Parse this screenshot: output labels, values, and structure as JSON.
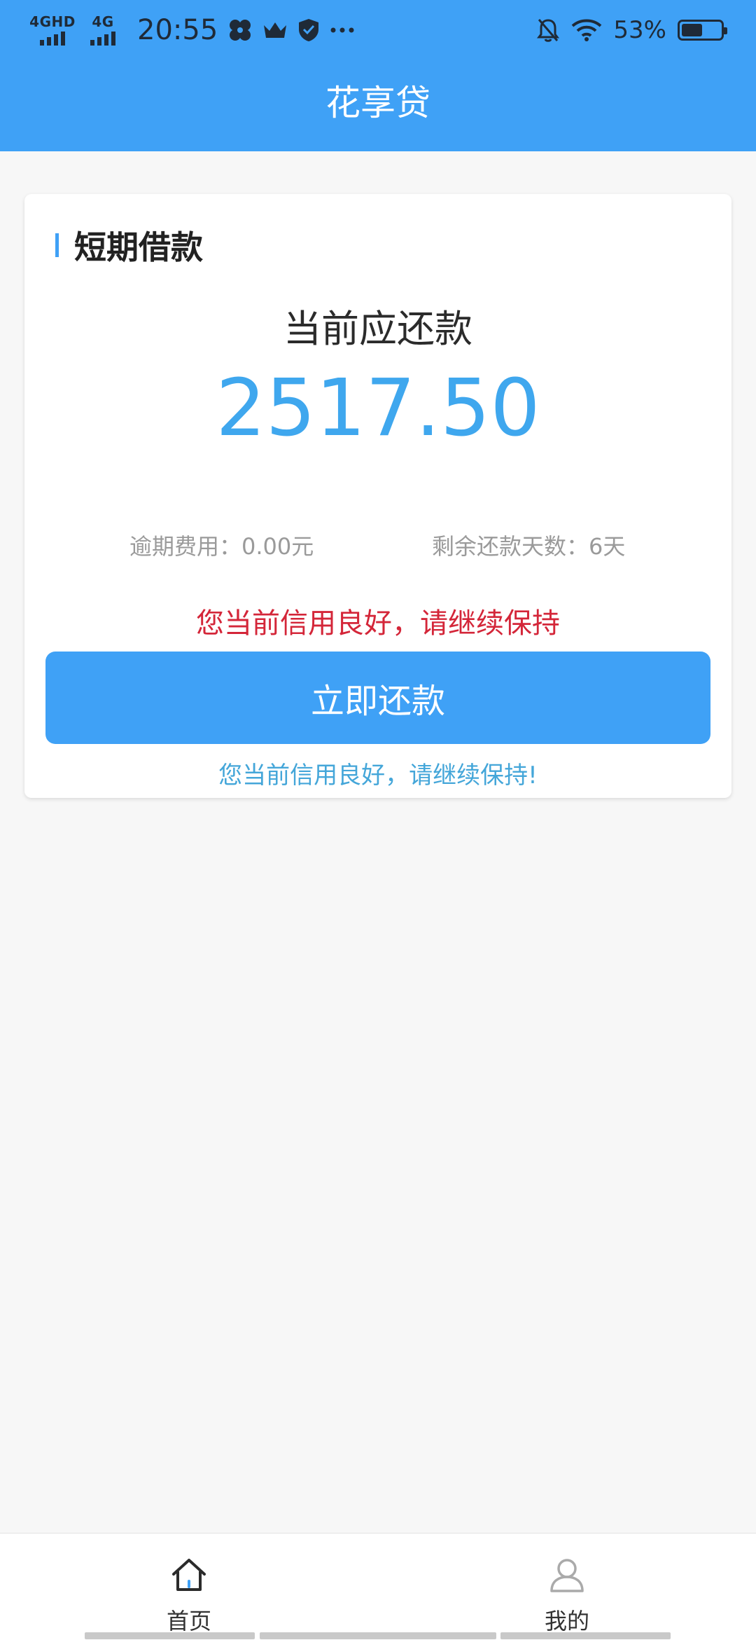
{
  "status_bar": {
    "network1": "4GHD",
    "network2": "4G",
    "time": "20:55",
    "battery_percent_text": "53%",
    "battery_level": 0.53,
    "icons": [
      "fan-icon",
      "crown-icon",
      "shield-check-icon",
      "more-dots-icon",
      "bell-off-icon",
      "wifi-icon",
      "battery-icon"
    ]
  },
  "header": {
    "title": "花享贷"
  },
  "card": {
    "section_title": "短期借款",
    "due_label": "当前应还款",
    "amount": "2517.50",
    "overdue_fee": "逾期费用：0.00元",
    "remaining_days": "剩余还款天数：6天",
    "credit_message": "您当前信用良好，请继续保持",
    "repay_button_label": "立即还款",
    "hint_message": "您当前信用良好，请继续保持!"
  },
  "bottom_nav": {
    "items": [
      {
        "label": "首页",
        "icon": "home-icon"
      },
      {
        "label": "我的",
        "icon": "user-icon"
      }
    ]
  },
  "colors": {
    "primary": "#3fa1f6",
    "amount": "#3fa7ee",
    "warning": "#d42639",
    "hint": "#44a6d9"
  }
}
